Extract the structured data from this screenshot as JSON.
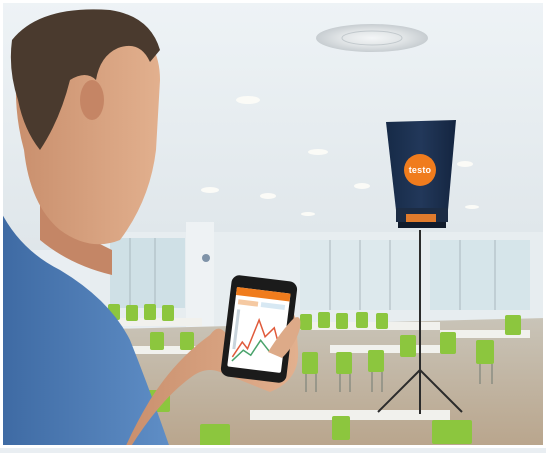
{
  "photo": {
    "brand_logo_text": "testo"
  },
  "colors": {
    "brand_orange": "#f07c1d",
    "hood_dark": "#1d3252",
    "chair_green": "#8cc63e",
    "shirt_blue": "#4f7fb8"
  },
  "icons": [
    "ceiling-vent-icon",
    "phone-icon",
    "testo-logo-icon",
    "tripod-icon"
  ]
}
